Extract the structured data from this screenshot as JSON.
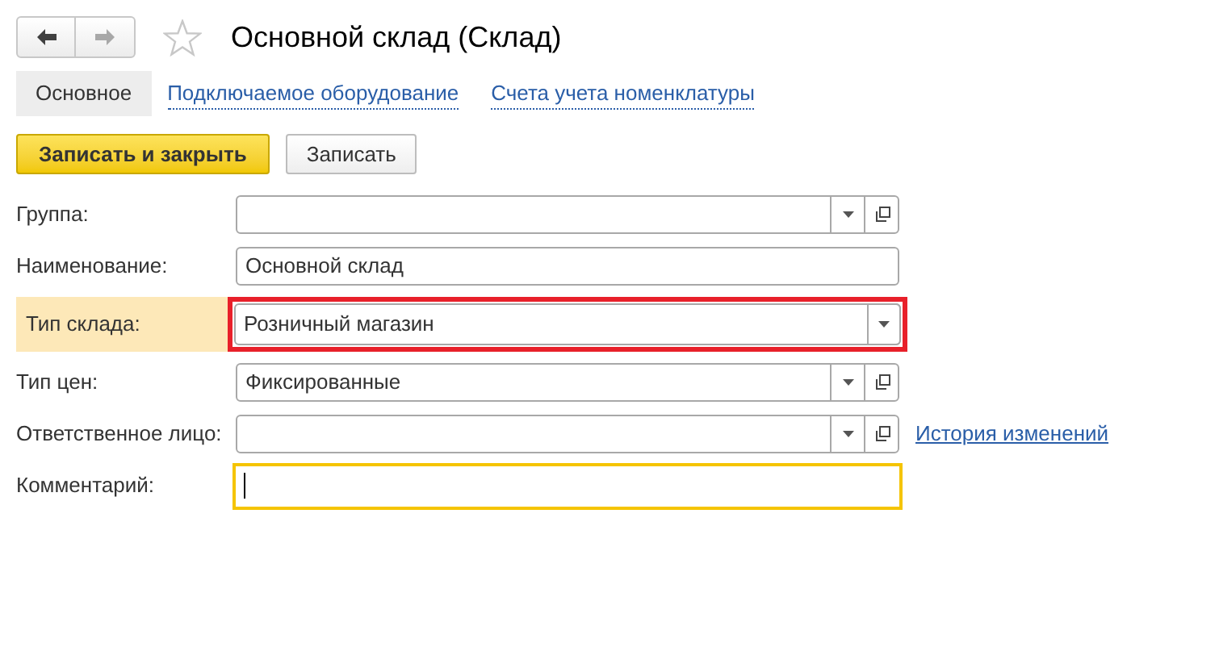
{
  "nav": [
    {
      "kind": "back",
      "disabled": false
    },
    {
      "kind": "forward",
      "disabled": true
    }
  ],
  "favorite": false,
  "title": "Основной склад (Склад)",
  "tabs": [
    {
      "label": "Основное",
      "selected": true
    },
    {
      "label": "Подключаемое оборудование",
      "selected": false
    },
    {
      "label": "Счета учета номенклатуры",
      "selected": false
    }
  ],
  "buttons": [
    {
      "label": "Записать и закрыть",
      "kind": "primary"
    },
    {
      "label": "Записать",
      "kind": "default"
    }
  ],
  "fields": [
    {
      "label": "Группа:",
      "dropdown": true,
      "open_button": true,
      "highlighted": false,
      "focused": false
    },
    {
      "label": "Наименование:",
      "value": "Основной склад",
      "dropdown": false,
      "open_button": false,
      "highlighted": false,
      "focused": false
    },
    {
      "label": "Тип склада:",
      "value": "Розничный магазин",
      "dropdown": true,
      "open_button": false,
      "highlighted": true,
      "focused": false
    },
    {
      "label": "Тип цен:",
      "value": "Фиксированные",
      "dropdown": true,
      "open_button": true,
      "highlighted": false,
      "focused": false
    },
    {
      "label": "Ответственное лицо:",
      "dropdown": true,
      "open_button": true,
      "highlighted": false,
      "focused": false,
      "link": "История изменений"
    },
    {
      "label": "Комментарий:",
      "dropdown": false,
      "open_button": false,
      "highlighted": false,
      "focused": true
    }
  ]
}
